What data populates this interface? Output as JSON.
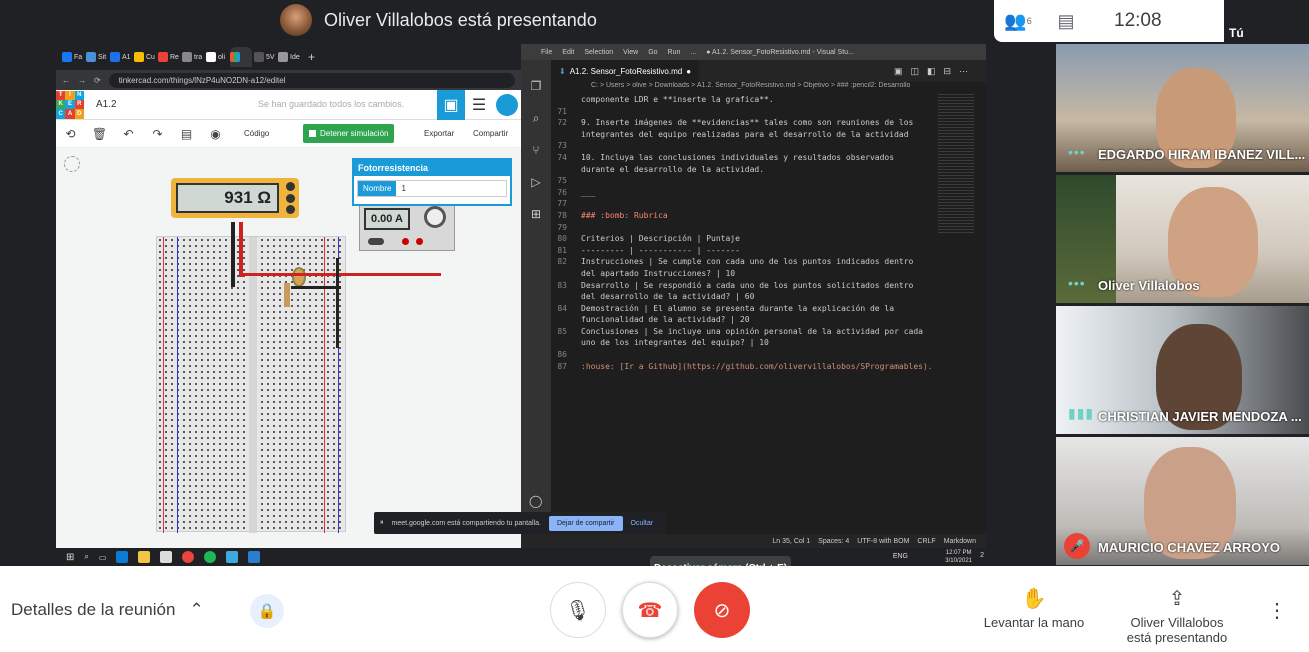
{
  "meet": {
    "presenting_banner": "Oliver Villalobos está presentando",
    "people_count": "6",
    "time": "12:08",
    "you_label": "Tú",
    "tooltip": "Desactivar cámara (Ctrl + E)",
    "details_label": "Detalles de la reunión",
    "raise_hand": "Levantar la mano",
    "presenter_line1": "Oliver Villalobos",
    "presenter_line2": "está presentando"
  },
  "participants": [
    {
      "name": "EDGARDO HIRAM IBANEZ VILL...",
      "status": "speaking-dots"
    },
    {
      "name": "Oliver Villalobos",
      "status": "speaking-dots"
    },
    {
      "name": "CHRISTIAN JAVIER MENDOZA ...",
      "status": "audio-bars"
    },
    {
      "name": "MAURICIO CHAVEZ ARROYO",
      "status": "muted"
    }
  ],
  "browser": {
    "tabs": [
      "Fa",
      "Sit",
      "A1",
      "Cu",
      "Re",
      "tra",
      "oli",
      "",
      "5V",
      "Ide"
    ],
    "url": "tinkercad.com/things/lNzP4uNO2DN-a12/editel"
  },
  "tinkercad": {
    "logo": [
      "TIN",
      "KER",
      "CAD"
    ],
    "title": "A1.2",
    "saved": "Se han guardado todos los cambios.",
    "code_btn": "Código",
    "sim_btn": "Detener simulación",
    "export": "Exportar",
    "share": "Compartir",
    "multimeter": "931 Ω",
    "psu": "0.00 A",
    "props_title": "Fotorresistencia",
    "props_label": "Nombre",
    "props_value": "1"
  },
  "vscode": {
    "menu": [
      "File",
      "Edit",
      "Selection",
      "View",
      "Go",
      "Run",
      "...",
      "● A1.2. Sensor_FotoResistivo.md - Visual Stu..."
    ],
    "tab": "A1.2. Sensor_FotoResistivo.md",
    "breadcrumb": "C: > Users > olive > Downloads > A1.2. Sensor_FotoResistivo.md > Objetivo > ### :pencil2: Desarrollo",
    "lines": [
      {
        "n": "",
        "t": "componente LDR e **inserte la grafica**."
      },
      {
        "n": "71",
        "t": ""
      },
      {
        "n": "72",
        "t": "9. Inserte imágenes de **evidencias** tales como son reuniones de los"
      },
      {
        "n": "",
        "t": "integrantes del equipo realizadas para el desarrollo de la actividad"
      },
      {
        "n": "73",
        "t": ""
      },
      {
        "n": "74",
        "t": "10. Incluya las conclusiones individuales y resultados observados"
      },
      {
        "n": "",
        "t": "durante el desarrollo de la actividad."
      },
      {
        "n": "75",
        "t": ""
      },
      {
        "n": "76",
        "t": "___"
      },
      {
        "n": "77",
        "t": ""
      },
      {
        "n": "78",
        "t": "### :bomb: Rubrica"
      },
      {
        "n": "79",
        "t": ""
      },
      {
        "n": "80",
        "t": "Criterios | Descripción | Puntaje"
      },
      {
        "n": "81",
        "t": "--------- | ----------- | -------"
      },
      {
        "n": "82",
        "t": "Instrucciones | Se cumple con cada uno de los puntos indicados dentro"
      },
      {
        "n": "",
        "t": "del apartado Instrucciones? | 10"
      },
      {
        "n": "83",
        "t": "Desarrollo | Se respondió a cada uno de los puntos solicitados dentro"
      },
      {
        "n": "",
        "t": "del desarrollo de la actividad? | 60"
      },
      {
        "n": "84",
        "t": "Demostración | El alumno se presenta durante la explicación de la"
      },
      {
        "n": "",
        "t": "funcionalidad de la actividad? | 20"
      },
      {
        "n": "85",
        "t": "Conclusiones | Se incluye una opinión personal de la actividad por cada"
      },
      {
        "n": "",
        "t": "uno de los integrantes del equipo? | 10"
      },
      {
        "n": "86",
        "t": ""
      },
      {
        "n": "87",
        "t": ":house: [Ir a Github](https://github.com/olivervillalobos/SProgramables)."
      }
    ],
    "status": [
      "Ln 35, Col 1",
      "Spaces: 4",
      "UTF-8 with BOM",
      "CRLF",
      "Markdown"
    ]
  },
  "share_notice": {
    "text": "meet.google.com está compartiendo tu pantalla.",
    "stop": "Dejar de compartir",
    "hide": "Ocultar"
  },
  "taskbar": {
    "lang": "ENG",
    "time": "12:07 PM",
    "date": "3/10/2021",
    "notif": "2"
  }
}
